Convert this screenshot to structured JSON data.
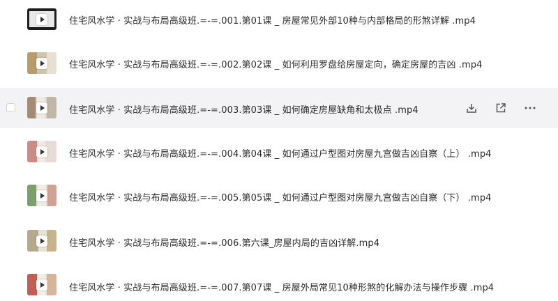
{
  "files": [
    {
      "name": "住宅风水学 · 实战与布局高级班.=-=.001.第01课 _ 房屋常见外部10种与内部格局的形煞详解 .mp4"
    },
    {
      "name": "住宅风水学 · 实战与布局高级班.=-=.002.第02课 _ 如何利用罗盘给房屋定向，确定房屋的吉凶 .mp4"
    },
    {
      "name": "住宅风水学 · 实战与布局高级班.=-=.003.第03课 _ 如何确定房屋缺角和太极点 .mp4"
    },
    {
      "name": "住宅风水学 · 实战与布局高级班.=-=.004.第04课 _ 如何通过户型图对房屋九宫做吉凶自察（上） .mp4"
    },
    {
      "name": "住宅风水学 · 实战与布局高级班.=-=.005.第05课 _ 如何通过户型图对房屋九宫做吉凶自察（下） .mp4"
    },
    {
      "name": "住宅风水学 · 实战与布局高级班.=-=.006.第六课_房屋内局的吉凶详解.mp4"
    },
    {
      "name": "住宅风水学 · 实战与布局高级班.=-=.007.第07课 _ 房屋外局常见10种形煞的化解办法与操作步骤 .mp4"
    }
  ],
  "hover_actions": [
    "download-icon",
    "share-icon",
    "more-icon"
  ],
  "colors": {
    "text": "#2b2b2b",
    "hover_row": "#f3f3f5",
    "icon": "#555555"
  }
}
